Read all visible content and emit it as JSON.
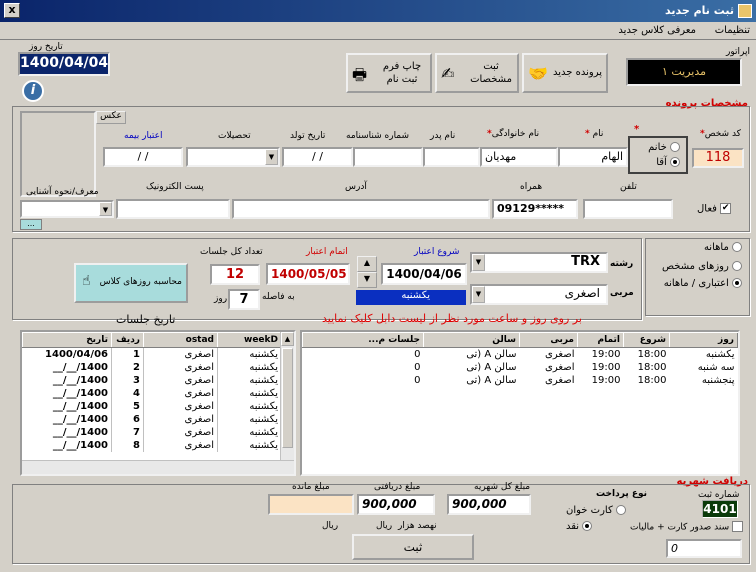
{
  "window": {
    "title": "ثبت نام جدید",
    "close": "x"
  },
  "menu": {
    "settings": "تنظیمات",
    "new_class": "معرفی کلاس جدید"
  },
  "header": {
    "operator_label": "اپراتور",
    "operator_value": "مدیریت ۱",
    "date_label": "تاریخ روز",
    "date_value": "1400/04/04"
  },
  "toolbar": {
    "new_file": "پرونده جدید",
    "register": "ثبت مشخصات",
    "print": "چاپ فرم ثبت نام"
  },
  "profile": {
    "section_title": "مشخصات پرونده",
    "code_label": "کد شخص",
    "code_value": "118",
    "gender_female": "خانم",
    "gender_male": "آقا",
    "name_label": "نام",
    "name_value": "الهام",
    "family_label": "نام خانوادگی",
    "family_value": "مهدیان",
    "father_label": "نام پدر",
    "father_value": "",
    "id_label": "شماره شناسنامه",
    "id_value": "",
    "birth_label": "تاریخ تولد",
    "birth_value": "/ /",
    "edu_label": "تحصیلات",
    "edu_value": "",
    "insurance_label": "اعتبار بیمه",
    "insurance_value": "/ /",
    "photo_label": "عکس",
    "phone_label": "تلفن",
    "phone_value": "",
    "mobile_label": "همراه",
    "mobile_value": "09129*****",
    "address_label": "آدرس",
    "address_value": "",
    "email_label": "پست الکترونیک",
    "email_value": "",
    "referrer_label": "معرف/نحوه آشنایی",
    "referrer_value": "",
    "active_label": "فعال",
    "more_btn": "..."
  },
  "course": {
    "monthly": "ماهانه",
    "specific_days": "روزهای مشخص",
    "credit_monthly": "اعتباری / ماهانه",
    "field_label": "رشته",
    "field_value": "TRX",
    "coach_label": "مربی",
    "coach_value": "اصغری",
    "start_label": "شروع اعتبار",
    "start_value": "1400/04/06",
    "start_day": "یکشنبه",
    "end_label": "اتمام اعتبار",
    "end_value": "1400/05/05",
    "sessions_label": "تعداد کل جلسات",
    "sessions_value": "12",
    "interval_label": "به فاصله",
    "interval_value": "7",
    "interval_unit": "روز",
    "calc_btn": "محاسبه روزهای کلاس",
    "hint": "بر روی روز و ساعت مورد نظر از لیست دابل کلیک نمایید",
    "history_title": "تاریخ جلسات"
  },
  "sessions": {
    "headers": [
      "weekD",
      "ostad",
      "ردیف",
      "تاریخ"
    ],
    "rows": [
      [
        "یکشنبه",
        "اصغری",
        "1",
        "1400/04/06"
      ],
      [
        "یکشنبه",
        "اصغری",
        "2",
        "1400/__/__"
      ],
      [
        "یکشنبه",
        "اصغری",
        "3",
        "1400/__/__"
      ],
      [
        "یکشنبه",
        "اصغری",
        "4",
        "1400/__/__"
      ],
      [
        "یکشنبه",
        "اصغری",
        "5",
        "1400/__/__"
      ],
      [
        "یکشنبه",
        "اصغری",
        "6",
        "1400/__/__"
      ],
      [
        "یکشنبه",
        "اصغری",
        "7",
        "1400/__/__"
      ],
      [
        "یکشنبه",
        "اصغری",
        "8",
        "1400/__/__"
      ]
    ]
  },
  "schedule": {
    "headers": [
      "روز",
      "شروع",
      "اتمام",
      "مربی",
      "سالن",
      "جلسات م..."
    ],
    "rows": [
      [
        "یکشنبه",
        "18:00",
        "19:00",
        "اصغری",
        "سالن A (تی",
        "0"
      ],
      [
        "سه شنبه",
        "18:00",
        "19:00",
        "اصغری",
        "سالن A (تی",
        "0"
      ],
      [
        "پنجشنبه",
        "18:00",
        "19:00",
        "اصغری",
        "سالن A (تی",
        "0"
      ]
    ]
  },
  "payment": {
    "section_title": "دریافت شهریه",
    "receipt_label": "شماره ثبت",
    "receipt_value": "4101",
    "method_label": "نوع پرداخت",
    "card": "کارت خوان",
    "cash": "نقد",
    "invoice_label": "سند صدور کارت + مالیات",
    "invoice_value": "0",
    "total_label": "مبلغ کل شهریه",
    "total_value": "900,000",
    "received_label": "مبلغ دریافتی",
    "received_value": "900,000",
    "remaining_label": "مبلغ مانده",
    "remaining_value": "",
    "words": "نهصد هزار",
    "currency": "ریال",
    "currency2": "ریال",
    "submit": "ثبت"
  }
}
